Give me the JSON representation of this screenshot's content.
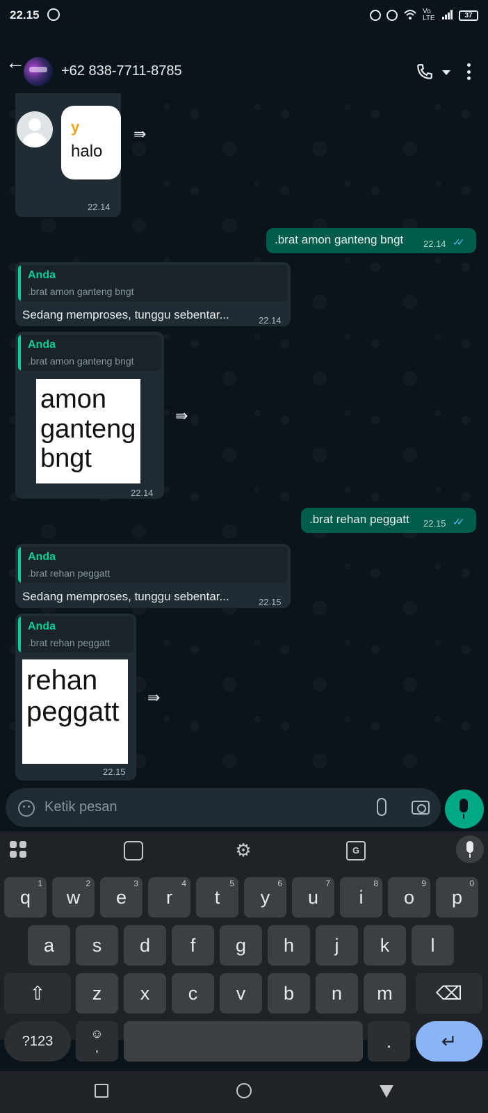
{
  "status_bar": {
    "time": "22.15",
    "network": "Vo LTE",
    "battery": "37"
  },
  "header": {
    "contact": "+62 838-7711-8785"
  },
  "messages": {
    "m1": {
      "reply_letter": "y",
      "reply_text": "halo",
      "time": "22.14"
    },
    "m2": {
      "text": ".brat amon ganteng bngt",
      "time": "22.14"
    },
    "m3": {
      "quote_author": "Anda",
      "quote_text": ".brat amon ganteng bngt",
      "text": "Sedang memproses, tunggu sebentar...",
      "time": "22.14"
    },
    "m4": {
      "quote_author": "Anda",
      "quote_text": ".brat amon ganteng bngt",
      "sticker_lines": [
        "amon",
        "ganteng",
        "bngt"
      ],
      "time": "22.14"
    },
    "m5": {
      "text": ".brat rehan peggatt",
      "time": "22.15"
    },
    "m6": {
      "quote_author": "Anda",
      "quote_text": ".brat rehan peggatt",
      "text": "Sedang memproses, tunggu sebentar...",
      "time": "22.15"
    },
    "m7": {
      "quote_author": "Anda",
      "quote_text": ".brat rehan peggatt",
      "sticker_lines": [
        "rehan",
        "peggatt"
      ],
      "time": "22.15"
    }
  },
  "input": {
    "placeholder": "Ketik pesan"
  },
  "keyboard": {
    "row1": [
      {
        "key": "q",
        "hint": "1"
      },
      {
        "key": "w",
        "hint": "2"
      },
      {
        "key": "e",
        "hint": "3"
      },
      {
        "key": "r",
        "hint": "4"
      },
      {
        "key": "t",
        "hint": "5"
      },
      {
        "key": "y",
        "hint": "6"
      },
      {
        "key": "u",
        "hint": "7"
      },
      {
        "key": "i",
        "hint": "8"
      },
      {
        "key": "o",
        "hint": "9"
      },
      {
        "key": "p",
        "hint": "0"
      }
    ],
    "row2": [
      "a",
      "s",
      "d",
      "f",
      "g",
      "h",
      "j",
      "k",
      "l"
    ],
    "row3": [
      "z",
      "x",
      "c",
      "v",
      "b",
      "n",
      "m"
    ],
    "shift": "⇧",
    "backspace": "⌫",
    "symbols": "?123",
    "emoji": "☺",
    "comma": ",",
    "period": ".",
    "enter": "↵",
    "settings": "⚙",
    "translate": "G"
  },
  "colors": {
    "background": "#0b141a",
    "incoming_bubble": "#202c33",
    "outgoing_bubble": "#005c4b",
    "accent_green": "#06cf9c",
    "mic_button": "#00a884",
    "enter_key": "#8ab4f8"
  }
}
